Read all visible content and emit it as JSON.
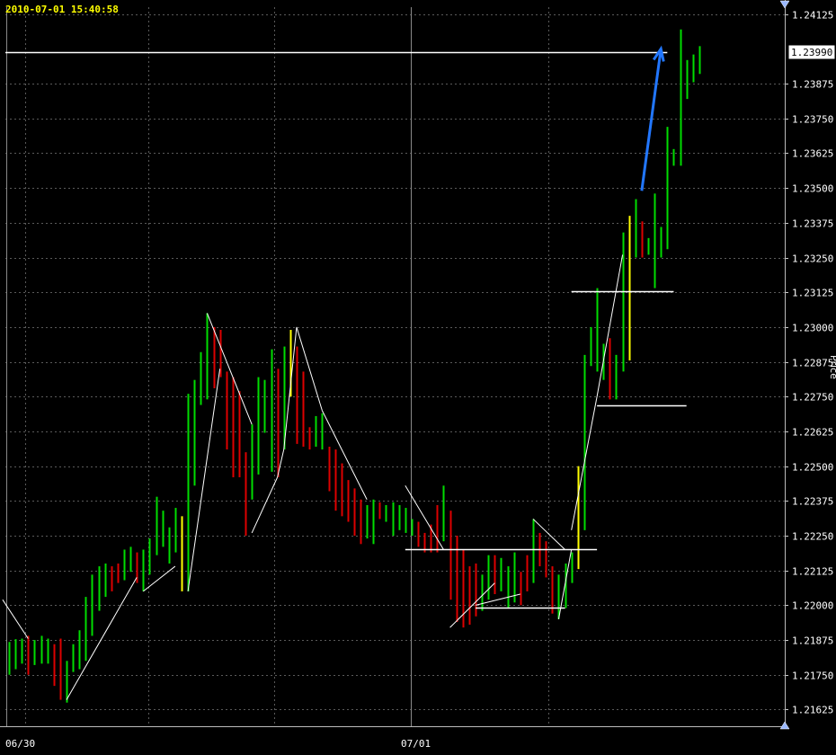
{
  "header": {
    "timestamp": "2010-07-01 15:40:58"
  },
  "axis": {
    "side_label": "Price"
  },
  "chart_data": {
    "type": "ohlc-bar",
    "title": "",
    "xlabel": "",
    "ylabel": "Price",
    "ylim": [
      1.21565,
      1.2415
    ],
    "y_ticks": [
      "1.24125",
      "1.23875",
      "1.23750",
      "1.23625",
      "1.23500",
      "1.23375",
      "1.23250",
      "1.23125",
      "1.23000",
      "1.22875",
      "1.22750",
      "1.22625",
      "1.22500",
      "1.22375",
      "1.22250",
      "1.22125",
      "1.22000",
      "1.21875",
      "1.21750",
      "1.21625"
    ],
    "x_ticks": [
      {
        "label": "06/30",
        "bar": 1
      },
      {
        "label": "07/01",
        "bar": 63
      }
    ],
    "grid": true,
    "current_price": "1.23990",
    "colors": {
      "up": "#00dd00",
      "down": "#dd0000",
      "neutral": "#ffff00",
      "grid": "#5a5a5a",
      "swing": "#ffffff",
      "arrow": "#2277ff",
      "price_box_bg": "#ffffff",
      "price_box_text": "#000000"
    },
    "bars": [
      {
        "h": 1.21868,
        "l": 1.2175,
        "c": "up"
      },
      {
        "h": 1.21878,
        "l": 1.2177,
        "c": "up"
      },
      {
        "h": 1.2188,
        "l": 1.2179,
        "c": "up"
      },
      {
        "h": 1.2189,
        "l": 1.2175,
        "c": "down"
      },
      {
        "h": 1.21875,
        "l": 1.21785,
        "c": "up"
      },
      {
        "h": 1.2189,
        "l": 1.2179,
        "c": "up"
      },
      {
        "h": 1.2188,
        "l": 1.2179,
        "c": "up"
      },
      {
        "h": 1.2186,
        "l": 1.2171,
        "c": "down"
      },
      {
        "h": 1.2188,
        "l": 1.2166,
        "c": "down"
      },
      {
        "h": 1.218,
        "l": 1.2165,
        "c": "up"
      },
      {
        "h": 1.2186,
        "l": 1.2176,
        "c": "up"
      },
      {
        "h": 1.2191,
        "l": 1.2177,
        "c": "up"
      },
      {
        "h": 1.2203,
        "l": 1.218,
        "c": "up"
      },
      {
        "h": 1.2211,
        "l": 1.2189,
        "c": "up"
      },
      {
        "h": 1.2214,
        "l": 1.2198,
        "c": "up"
      },
      {
        "h": 1.2215,
        "l": 1.2203,
        "c": "up"
      },
      {
        "h": 1.2214,
        "l": 1.2205,
        "c": "down"
      },
      {
        "h": 1.2215,
        "l": 1.2208,
        "c": "down"
      },
      {
        "h": 1.222,
        "l": 1.2209,
        "c": "up"
      },
      {
        "h": 1.2221,
        "l": 1.2212,
        "c": "up"
      },
      {
        "h": 1.2219,
        "l": 1.2208,
        "c": "down"
      },
      {
        "h": 1.222,
        "l": 1.2205,
        "c": "up"
      },
      {
        "h": 1.2224,
        "l": 1.2211,
        "c": "up"
      },
      {
        "h": 1.2239,
        "l": 1.2218,
        "c": "up"
      },
      {
        "h": 1.2234,
        "l": 1.2221,
        "c": "up"
      },
      {
        "h": 1.2228,
        "l": 1.2215,
        "c": "up"
      },
      {
        "h": 1.2235,
        "l": 1.2219,
        "c": "up"
      },
      {
        "h": 1.2232,
        "l": 1.2205,
        "c": "yellow"
      },
      {
        "h": 1.2276,
        "l": 1.2205,
        "c": "up"
      },
      {
        "h": 1.2281,
        "l": 1.2243,
        "c": "up"
      },
      {
        "h": 1.2291,
        "l": 1.2272,
        "c": "up"
      },
      {
        "h": 1.2305,
        "l": 1.2274,
        "c": "up"
      },
      {
        "h": 1.23,
        "l": 1.2278,
        "c": "down"
      },
      {
        "h": 1.2299,
        "l": 1.2282,
        "c": "down"
      },
      {
        "h": 1.2284,
        "l": 1.2256,
        "c": "down"
      },
      {
        "h": 1.2282,
        "l": 1.2246,
        "c": "down"
      },
      {
        "h": 1.2277,
        "l": 1.2246,
        "c": "down"
      },
      {
        "h": 1.2255,
        "l": 1.2225,
        "c": "down"
      },
      {
        "h": 1.2265,
        "l": 1.2238,
        "c": "up"
      },
      {
        "h": 1.2282,
        "l": 1.2247,
        "c": "up"
      },
      {
        "h": 1.2281,
        "l": 1.2262,
        "c": "up"
      },
      {
        "h": 1.2292,
        "l": 1.2248,
        "c": "up"
      },
      {
        "h": 1.2285,
        "l": 1.2246,
        "c": "down"
      },
      {
        "h": 1.2293,
        "l": 1.2256,
        "c": "up"
      },
      {
        "h": 1.2299,
        "l": 1.2275,
        "c": "yellow"
      },
      {
        "h": 1.2293,
        "l": 1.2258,
        "c": "down"
      },
      {
        "h": 1.2284,
        "l": 1.2257,
        "c": "down"
      },
      {
        "h": 1.2264,
        "l": 1.2256,
        "c": "down"
      },
      {
        "h": 1.2268,
        "l": 1.2257,
        "c": "up"
      },
      {
        "h": 1.2269,
        "l": 1.2256,
        "c": "up"
      },
      {
        "h": 1.2257,
        "l": 1.2241,
        "c": "down"
      },
      {
        "h": 1.2256,
        "l": 1.2234,
        "c": "down"
      },
      {
        "h": 1.2251,
        "l": 1.2232,
        "c": "down"
      },
      {
        "h": 1.2245,
        "l": 1.223,
        "c": "down"
      },
      {
        "h": 1.2242,
        "l": 1.2225,
        "c": "down"
      },
      {
        "h": 1.2238,
        "l": 1.2222,
        "c": "down"
      },
      {
        "h": 1.2236,
        "l": 1.2224,
        "c": "up"
      },
      {
        "h": 1.2238,
        "l": 1.2222,
        "c": "up"
      },
      {
        "h": 1.2237,
        "l": 1.2231,
        "c": "down"
      },
      {
        "h": 1.2236,
        "l": 1.223,
        "c": "up"
      },
      {
        "h": 1.2237,
        "l": 1.2225,
        "c": "up"
      },
      {
        "h": 1.2236,
        "l": 1.2227,
        "c": "up"
      },
      {
        "h": 1.2235,
        "l": 1.2226,
        "c": "up"
      },
      {
        "h": 1.2231,
        "l": 1.2225,
        "c": "up"
      },
      {
        "h": 1.223,
        "l": 1.2221,
        "c": "down"
      },
      {
        "h": 1.2226,
        "l": 1.2219,
        "c": "down"
      },
      {
        "h": 1.2229,
        "l": 1.2219,
        "c": "down"
      },
      {
        "h": 1.2236,
        "l": 1.2219,
        "c": "down"
      },
      {
        "h": 1.2243,
        "l": 1.2223,
        "c": "up"
      },
      {
        "h": 1.2234,
        "l": 1.2202,
        "c": "down"
      },
      {
        "h": 1.2225,
        "l": 1.2194,
        "c": "down"
      },
      {
        "h": 1.222,
        "l": 1.2192,
        "c": "down"
      },
      {
        "h": 1.2214,
        "l": 1.2193,
        "c": "down"
      },
      {
        "h": 1.2215,
        "l": 1.2196,
        "c": "down"
      },
      {
        "h": 1.2211,
        "l": 1.2198,
        "c": "up"
      },
      {
        "h": 1.2218,
        "l": 1.2202,
        "c": "up"
      },
      {
        "h": 1.2218,
        "l": 1.2204,
        "c": "down"
      },
      {
        "h": 1.2217,
        "l": 1.2205,
        "c": "up"
      },
      {
        "h": 1.2214,
        "l": 1.2199,
        "c": "up"
      },
      {
        "h": 1.2219,
        "l": 1.2201,
        "c": "up"
      },
      {
        "h": 1.2212,
        "l": 1.22,
        "c": "down"
      },
      {
        "h": 1.2218,
        "l": 1.2205,
        "c": "down"
      },
      {
        "h": 1.2231,
        "l": 1.2208,
        "c": "up"
      },
      {
        "h": 1.2226,
        "l": 1.2214,
        "c": "down"
      },
      {
        "h": 1.2223,
        "l": 1.221,
        "c": "down"
      },
      {
        "h": 1.2214,
        "l": 1.2197,
        "c": "down"
      },
      {
        "h": 1.2211,
        "l": 1.2195,
        "c": "up"
      },
      {
        "h": 1.2215,
        "l": 1.2199,
        "c": "up"
      },
      {
        "h": 1.2219,
        "l": 1.2208,
        "c": "up"
      },
      {
        "h": 1.225,
        "l": 1.2213,
        "c": "yellow"
      },
      {
        "h": 1.229,
        "l": 1.2227,
        "c": "up"
      },
      {
        "h": 1.23,
        "l": 1.2286,
        "c": "up"
      },
      {
        "h": 1.2314,
        "l": 1.2284,
        "c": "up"
      },
      {
        "h": 1.2294,
        "l": 1.2281,
        "c": "up"
      },
      {
        "h": 1.2296,
        "l": 1.2274,
        "c": "down"
      },
      {
        "h": 1.229,
        "l": 1.2274,
        "c": "up"
      },
      {
        "h": 1.2334,
        "l": 1.2284,
        "c": "up"
      },
      {
        "h": 1.234,
        "l": 1.2288,
        "c": "yellow"
      },
      {
        "h": 1.2346,
        "l": 1.2325,
        "c": "up"
      },
      {
        "h": 1.2338,
        "l": 1.2325,
        "c": "down"
      },
      {
        "h": 1.2332,
        "l": 1.2326,
        "c": "up"
      },
      {
        "h": 1.2348,
        "l": 1.2314,
        "c": "up"
      },
      {
        "h": 1.2336,
        "l": 1.2325,
        "c": "up"
      },
      {
        "h": 1.2372,
        "l": 1.2328,
        "c": "up"
      },
      {
        "h": 1.2364,
        "l": 1.2358,
        "c": "up"
      },
      {
        "h": 1.2407,
        "l": 1.2358,
        "c": "up"
      },
      {
        "h": 1.2396,
        "l": 1.2382,
        "c": "up"
      },
      {
        "h": 1.2398,
        "l": 1.2388,
        "c": "up"
      },
      {
        "h": 1.2401,
        "l": 1.2391,
        "c": "up"
      }
    ],
    "swing_lines": [
      [
        [
          -1,
          1.2202
        ],
        [
          3,
          1.2188
        ]
      ],
      [
        [
          9,
          1.2166
        ],
        [
          20,
          1.221
        ]
      ],
      [
        [
          21,
          1.2205
        ],
        [
          26,
          1.2214
        ]
      ],
      [
        [
          28,
          1.2205
        ],
        [
          33,
          1.2285
        ]
      ],
      [
        [
          31,
          1.2305
        ],
        [
          38,
          1.2265
        ]
      ],
      [
        [
          38,
          1.2226
        ],
        [
          42,
          1.2246
        ]
      ],
      [
        [
          42,
          1.2246
        ],
        [
          43,
          1.2256
        ]
      ],
      [
        [
          43,
          1.2256
        ],
        [
          45,
          1.23
        ]
      ],
      [
        [
          45,
          1.23
        ],
        [
          49,
          1.227
        ]
      ],
      [
        [
          49,
          1.227
        ],
        [
          56,
          1.2238
        ]
      ],
      [
        [
          62,
          1.2243
        ],
        [
          68,
          1.222
        ]
      ],
      [
        [
          69,
          1.2192
        ],
        [
          76,
          1.2208
        ]
      ],
      [
        [
          73,
          1.22
        ],
        [
          80,
          1.2204
        ]
      ],
      [
        [
          82,
          1.2231
        ],
        [
          87,
          1.222
        ]
      ],
      [
        [
          86,
          1.2195
        ],
        [
          88,
          1.222
        ]
      ],
      [
        [
          88,
          1.2227
        ],
        [
          92,
          1.2275
        ]
      ],
      [
        [
          92,
          1.2275
        ],
        [
          96,
          1.2326
        ]
      ]
    ],
    "horizontal_lines": [
      {
        "y": 1.2399,
        "from": -1,
        "to": 103
      },
      {
        "y": 1.2313,
        "from": 88,
        "to": 104
      },
      {
        "y": 1.2272,
        "from": 92,
        "to": 106
      },
      {
        "y": 1.222,
        "from": 62,
        "to": 92
      },
      {
        "y": 1.2199,
        "from": 73,
        "to": 87
      }
    ],
    "arrow": {
      "from": [
        99,
        1.2349
      ],
      "to": [
        102,
        1.24
      ]
    }
  }
}
